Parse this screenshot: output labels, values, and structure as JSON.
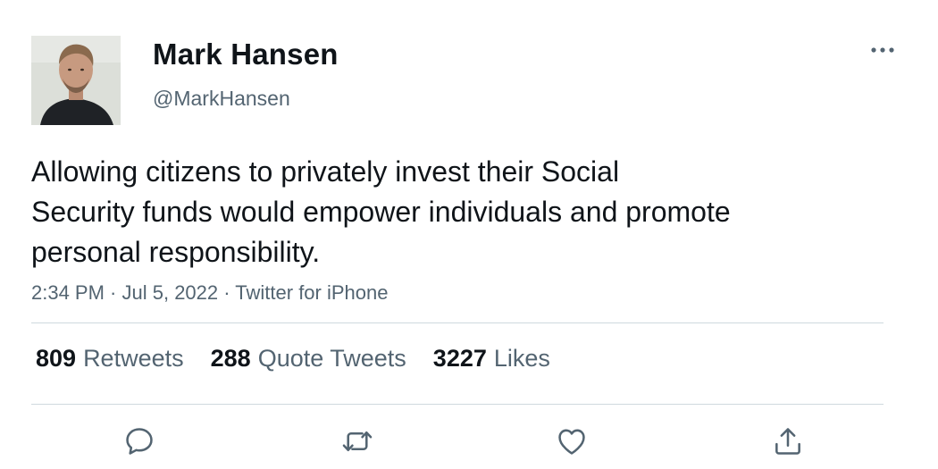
{
  "tweet": {
    "author": {
      "name": "Mark Hansen",
      "handle": "@MarkHansen"
    },
    "more_icon": "more-dots-icon",
    "text_lines": [
      "Allowing citizens to privately invest their Social",
      "Security funds would empower individuals and promote",
      "personal responsibility."
    ],
    "meta": {
      "time": "2:34 PM",
      "sep1": " · ",
      "date": "Jul 5, 2022",
      "sep2": " · ",
      "source": "Twitter for iPhone"
    },
    "stats": {
      "retweets": {
        "count": "809",
        "label": "Retweets"
      },
      "quotes": {
        "count": "288",
        "label": "Quote Tweets"
      },
      "likes": {
        "count": "3227",
        "label": "Likes"
      }
    },
    "actions": [
      {
        "name": "reply",
        "icon": "reply-icon"
      },
      {
        "name": "retweet",
        "icon": "retweet-icon"
      },
      {
        "name": "like",
        "icon": "heart-icon"
      },
      {
        "name": "share",
        "icon": "share-icon"
      }
    ],
    "colors": {
      "text": "#0f1419",
      "secondary": "#536471",
      "divider": "#cfd9de"
    }
  }
}
